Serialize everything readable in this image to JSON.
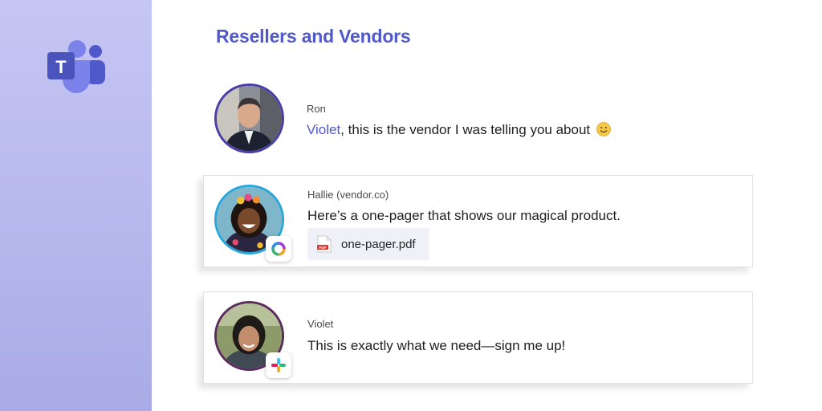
{
  "channel": {
    "title": "Resellers and Vendors"
  },
  "messages": [
    {
      "sender": "Ron",
      "mention": "Violet",
      "text": ", this is the vendor I was telling you about",
      "emoji": "smile-emoji"
    },
    {
      "sender": "Hallie (vendor.co)",
      "text": "Here’s a one-pager that shows our magical product.",
      "app_icon": "webex-icon",
      "attachment": {
        "name": "one-pager.pdf",
        "icon": "pdf-icon",
        "badge": "PDF"
      }
    },
    {
      "sender": "Violet",
      "text": "This is exactly what we need—sign me up!",
      "app_icon": "slack-icon"
    }
  ],
  "brand": {
    "logo": "teams-logo",
    "letter": "T",
    "accent": "#5059c9",
    "sidebar": "#b3b5ea"
  }
}
